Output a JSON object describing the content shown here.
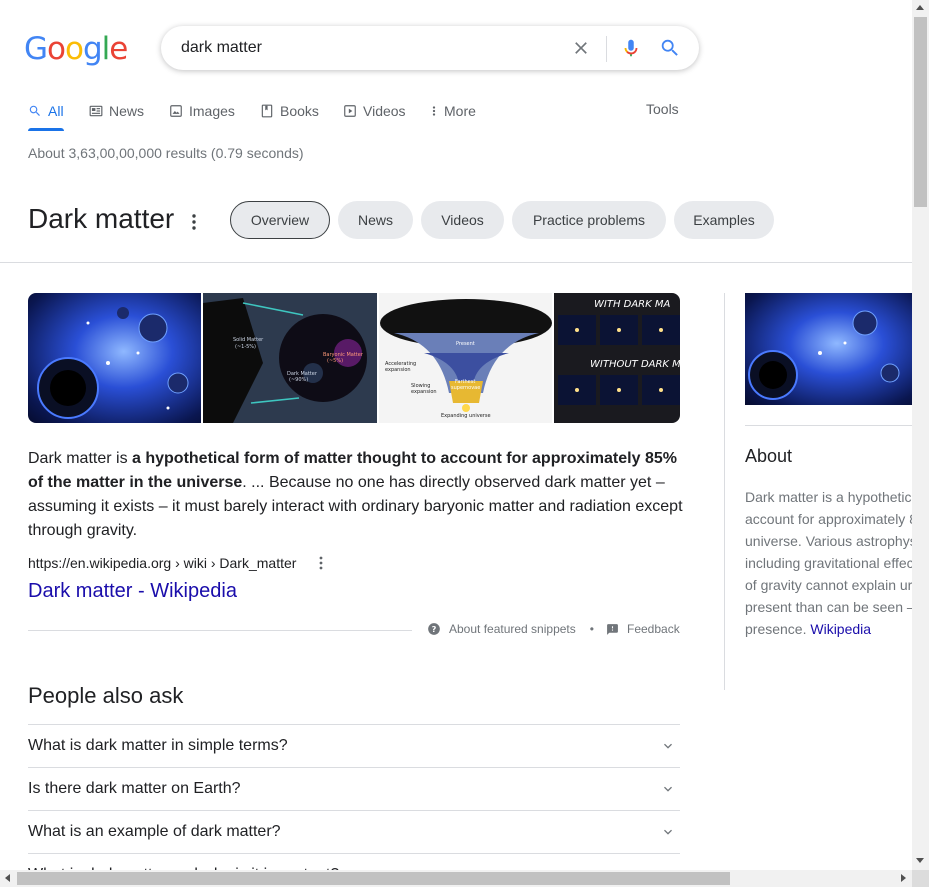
{
  "logo": {
    "letters": [
      "G",
      "o",
      "o",
      "g",
      "l",
      "e"
    ],
    "colors": [
      "#4285f4",
      "#ea4335",
      "#fbbc05",
      "#4285f4",
      "#34a853",
      "#ea4335"
    ]
  },
  "search": {
    "value": "dark matter"
  },
  "tabs": [
    {
      "label": "All",
      "icon": "search-icon",
      "active": true
    },
    {
      "label": "News",
      "icon": "news-icon"
    },
    {
      "label": "Images",
      "icon": "image-icon"
    },
    {
      "label": "Books",
      "icon": "book-icon"
    },
    {
      "label": "Videos",
      "icon": "video-icon"
    },
    {
      "label": "More",
      "icon": "more-vert-icon"
    }
  ],
  "tools_label": "Tools",
  "result_stats": "About 3,63,00,00,000 results (0.79 seconds)",
  "knowledge_panel": {
    "title": "Dark matter",
    "chips": [
      "Overview",
      "News",
      "Videos",
      "Practice problems",
      "Examples"
    ],
    "selected_chip": "Overview"
  },
  "images": [
    {
      "alt": "dark matter space art",
      "overlay_text": ""
    },
    {
      "alt": "dark matter composition pie",
      "overlay_text": [
        "Solid Matter (~1-5%)",
        "Dark Matter (~90%)",
        "Baryonic Matter (~5%)"
      ]
    },
    {
      "alt": "expanding universe diagram",
      "overlay_text": [
        "Present",
        "Accelerating expansion",
        "Farthest supernovae",
        "Slowing expansion",
        "Expanding universe"
      ]
    },
    {
      "alt": "galaxy with and without dark matter",
      "overlay_text": [
        "WITH DARK MA",
        "WITHOUT DARK MA"
      ]
    }
  ],
  "snippet": {
    "prefix": "Dark matter is ",
    "bold": "a hypothetical form of matter thought to account for approximately 85% of the matter in the universe",
    "suffix": ". ... Because no one has directly observed dark matter yet – assuming it exists – it must barely interact with ordinary baryonic matter and radiation except through gravity.",
    "cite": "https://en.wikipedia.org › wiki › Dark_matter",
    "link_title": "Dark matter - Wikipedia",
    "about_label": "About featured snippets",
    "separator": "•",
    "feedback_label": "Feedback"
  },
  "people_also_ask": {
    "title": "People also ask",
    "questions": [
      "What is dark matter in simple terms?",
      "Is there dark matter on Earth?",
      "What is an example of dark matter?",
      "What is dark matter and why is it important?"
    ]
  },
  "right_panel": {
    "about_title": "About",
    "desc_lines": [
      "Dark matter is a hypothetic",
      "account for approximately 8",
      "universe. Various astrophys",
      "including gravitational effec",
      "of gravity cannot explain ur",
      "present than can be seen –",
      "presence. "
    ],
    "source": "Wikipedia"
  }
}
